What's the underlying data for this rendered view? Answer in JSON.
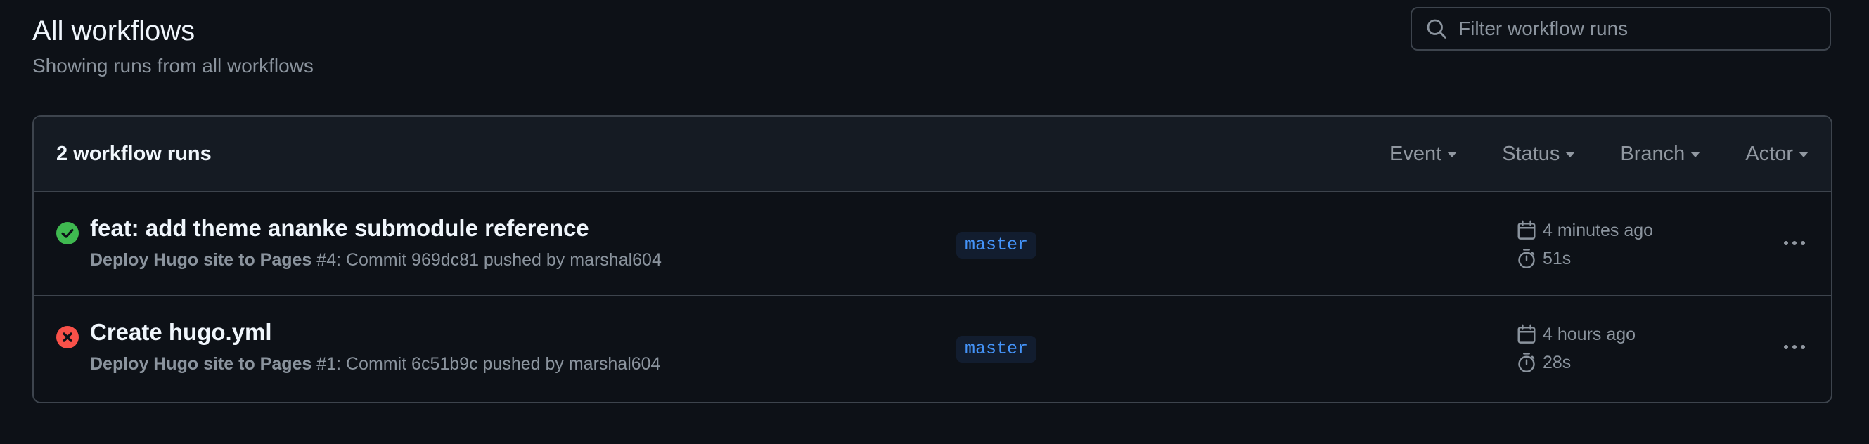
{
  "header": {
    "title": "All workflows",
    "subtitle": "Showing runs from all workflows"
  },
  "search": {
    "placeholder": "Filter workflow runs",
    "value": ""
  },
  "runs_panel": {
    "count_label": "2 workflow runs",
    "filters": [
      {
        "label": "Event"
      },
      {
        "label": "Status"
      },
      {
        "label": "Branch"
      },
      {
        "label": "Actor"
      }
    ],
    "runs": [
      {
        "status": "success",
        "status_icon": "check-circle-icon",
        "status_color": "#3fb950",
        "title": "feat: add theme ananke submodule reference",
        "workflow_name": "Deploy Hugo site to Pages",
        "run_number": " #4",
        "detail": ": Commit 969dc81 pushed by marshal604",
        "branch": "master",
        "started": "4 minutes ago",
        "duration": "51s"
      },
      {
        "status": "failure",
        "status_icon": "x-circle-icon",
        "status_color": "#f85149",
        "title": "Create hugo.yml",
        "workflow_name": "Deploy Hugo site to Pages",
        "run_number": " #1",
        "detail": ": Commit 6c51b9c pushed by marshal604",
        "branch": "master",
        "started": "4 hours ago",
        "duration": "28s"
      }
    ]
  },
  "colors": {
    "background": "#0d1117",
    "header_bg": "#151b23",
    "border": "#3d444d",
    "branch_text": "#4493f8",
    "branch_bg": "#121d2f"
  }
}
